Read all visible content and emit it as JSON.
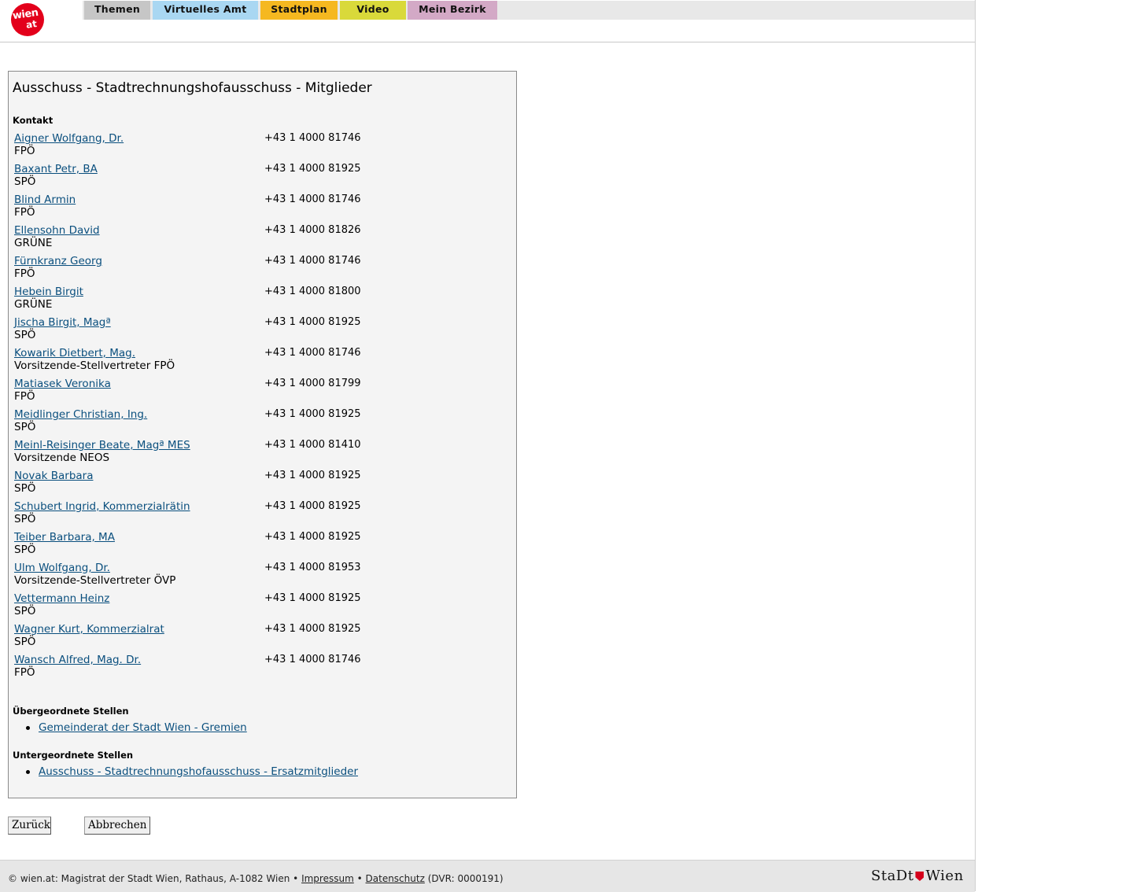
{
  "header": {
    "logo_word": "wien",
    "logo_suffix": "at",
    "tabs": [
      {
        "label": "Themen",
        "color": "#c6c6c6"
      },
      {
        "label": "Virtuelles Amt",
        "color": "#a9d7f2"
      },
      {
        "label": "Stadtplan",
        "color": "#f5b820"
      },
      {
        "label": "Video",
        "color": "#d9d93a"
      },
      {
        "label": "Mein Bezirk",
        "color": "#d3a9c6"
      }
    ]
  },
  "main": {
    "title": "Ausschuss - Stadtrechnungshofausschuss - Mitglieder",
    "contact_label": "Kontakt",
    "members": [
      {
        "name": "Aigner Wolfgang, Dr.",
        "party": "FPÖ",
        "phone": "+43 1 4000 81746"
      },
      {
        "name": "Baxant Petr, BA",
        "party": "SPÖ",
        "phone": "+43 1 4000 81925"
      },
      {
        "name": "Blind Armin",
        "party": "FPÖ",
        "phone": "+43 1 4000 81746"
      },
      {
        "name": "Ellensohn David",
        "party": "GRÜNE",
        "phone": "+43 1 4000 81826"
      },
      {
        "name": "Fürnkranz Georg",
        "party": "FPÖ",
        "phone": "+43 1 4000 81746"
      },
      {
        "name": "Hebein Birgit",
        "party": "GRÜNE",
        "phone": "+43 1 4000 81800"
      },
      {
        "name": "Jischa Birgit, Magª",
        "party": "SPÖ",
        "phone": "+43 1 4000 81925"
      },
      {
        "name": "Kowarik Dietbert, Mag.",
        "party": "Vorsitzende-Stellvertreter FPÖ",
        "phone": "+43 1 4000 81746"
      },
      {
        "name": "Matiasek Veronika",
        "party": "FPÖ",
        "phone": "+43 1 4000 81799"
      },
      {
        "name": "Meidlinger Christian, Ing.",
        "party": "SPÖ",
        "phone": "+43 1 4000 81925"
      },
      {
        "name": "Meinl-Reisinger Beate, Magª MES",
        "party": "Vorsitzende NEOS",
        "phone": "+43 1 4000 81410"
      },
      {
        "name": "Novak Barbara",
        "party": "SPÖ",
        "phone": "+43 1 4000 81925"
      },
      {
        "name": "Schubert Ingrid, Kommerzialrätin",
        "party": "SPÖ",
        "phone": "+43 1 4000 81925"
      },
      {
        "name": "Teiber Barbara, MA",
        "party": "SPÖ",
        "phone": "+43 1 4000 81925"
      },
      {
        "name": "Ulm Wolfgang, Dr.",
        "party": "Vorsitzende-Stellvertreter ÖVP",
        "phone": "+43 1 4000 81953"
      },
      {
        "name": "Vettermann Heinz",
        "party": "SPÖ",
        "phone": "+43 1 4000 81925"
      },
      {
        "name": "Wagner Kurt, Kommerzialrat",
        "party": "SPÖ",
        "phone": "+43 1 4000 81925"
      },
      {
        "name": "Wansch Alfred, Mag. Dr.",
        "party": "FPÖ",
        "phone": "+43 1 4000 81746"
      }
    ],
    "parent_label": "Übergeordnete Stellen",
    "parent_link": "Gemeinderat der Stadt Wien - Gremien",
    "child_label": "Untergeordnete Stellen",
    "child_link": "Ausschuss - Stadtrechnungshofausschuss - Ersatzmitglieder"
  },
  "buttons": {
    "back": "Zurück",
    "cancel": "Abbrechen"
  },
  "footer": {
    "prefix": "© wien.at: Magistrat der Stadt Wien, Rathaus, A-1082 Wien •",
    "impressum": "Impressum",
    "separator": "•",
    "datenschutz": "Datenschutz",
    "dvr": "(DVR: 0000191)",
    "logo_left": "StaDt",
    "logo_right": "Wien"
  }
}
